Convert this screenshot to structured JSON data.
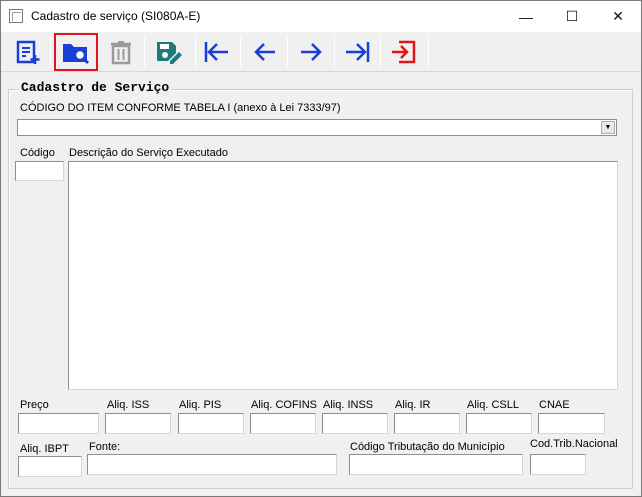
{
  "window": {
    "title": "Cadastro de serviço  (SI080A-E)",
    "minimize": "—",
    "maximize": "☐",
    "close": "✕"
  },
  "toolbar": {
    "items": [
      "new-record",
      "search-folder",
      "delete-trash",
      "save-edit",
      "first-record",
      "previous-record",
      "next-record",
      "last-record",
      "exit"
    ],
    "accent_blue": "#1a3fd8",
    "accent_teal": "#1c7c7c",
    "accent_red": "#e0141c"
  },
  "form": {
    "group_title": "Cadastro de Serviço",
    "item_code_label": "CÓDIGO DO ITEM CONFORME TABELA I (anexo à Lei 7333/97)",
    "item_code_value": "",
    "codigo_label": "Código",
    "descricao_label": "Descrição do Serviço Executado",
    "preco_label": "Preço",
    "aliq_iss_label": "Aliq. ISS",
    "aliq_pis_label": "Aliq. PIS",
    "aliq_cofins_label": "Aliq. COFINS",
    "aliq_inss_label": "Aliq. INSS",
    "aliq_ir_label": "Aliq. IR",
    "aliq_csll_label": "Aliq. CSLL",
    "cnae_label": "CNAE",
    "aliq_ibpt_label": "Aliq. IBPT",
    "fonte_label": "Fonte:",
    "cod_trib_municipio_label": "Código Tributação do Município",
    "cod_trib_nacional_label": "Cod.Trib.Nacional"
  }
}
